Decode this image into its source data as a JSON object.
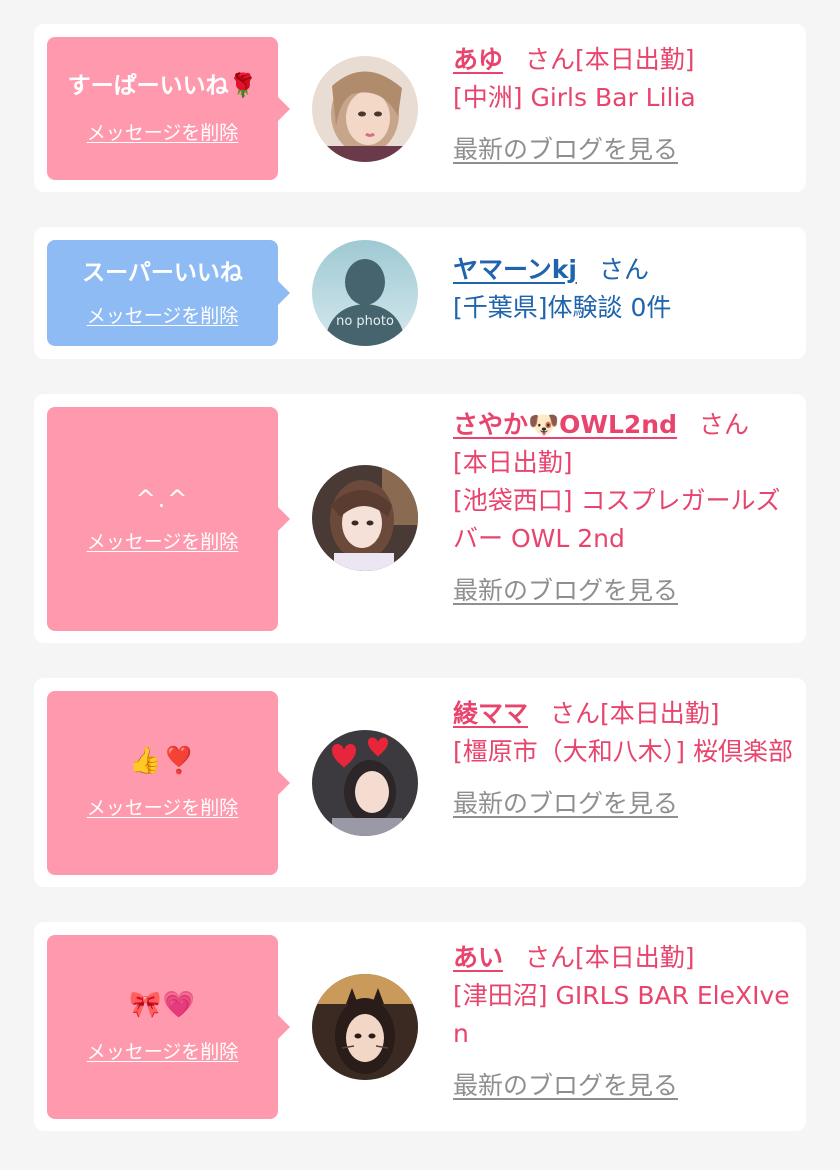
{
  "colors": {
    "pink_accent": "#e8446d",
    "pink_bubble": "#ff99ad",
    "blue_bubble": "#8fbbf4",
    "blue_text": "#1f64ad",
    "gray_link": "#8f8f8f",
    "background": "#f5f5f5"
  },
  "messages": [
    {
      "bubble_text": "すーぱーいいね🌹",
      "delete_label": "メッセージを削除",
      "name": "あゆ",
      "suffix": "さん[本日出勤]",
      "status": "",
      "shop": "[中洲] Girls Bar Lilia",
      "blog_label": "最新のブログを見る",
      "avatar_icon": "cast-photo"
    },
    {
      "bubble_text": "スーパーいいね",
      "delete_label": "メッセージを削除",
      "name": "ヤマーンkj",
      "suffix": "さん",
      "status": "",
      "shop": "[千葉県]体験談 0件",
      "blog_label": "",
      "avatar_icon": "no-photo-silhouette",
      "avatar_text": "no photo"
    },
    {
      "bubble_text": "^.^",
      "delete_label": "メッセージを削除",
      "name": "さやか🐶OWL2nd",
      "suffix": "さん",
      "status": "[本日出勤]",
      "shop": "[池袋西口] コスプレガールズバー OWL 2nd",
      "blog_label": "最新のブログを見る",
      "avatar_icon": "cast-photo"
    },
    {
      "bubble_text": "👍❣️",
      "delete_label": "メッセージを削除",
      "name": "綾ママ",
      "suffix": "さん[本日出勤]",
      "status": "",
      "shop": "[橿原市（大和八木）] 桜倶楽部",
      "blog_label": "最新のブログを見る",
      "avatar_icon": "cast-photo"
    },
    {
      "bubble_text": "🎀💗",
      "delete_label": "メッセージを削除",
      "name": "あい",
      "suffix": "さん[本日出勤]",
      "status": "",
      "shop": "[津田沼] GIRLS BAR EleXIven",
      "blog_label": "最新のブログを見る",
      "avatar_icon": "cast-photo"
    }
  ]
}
